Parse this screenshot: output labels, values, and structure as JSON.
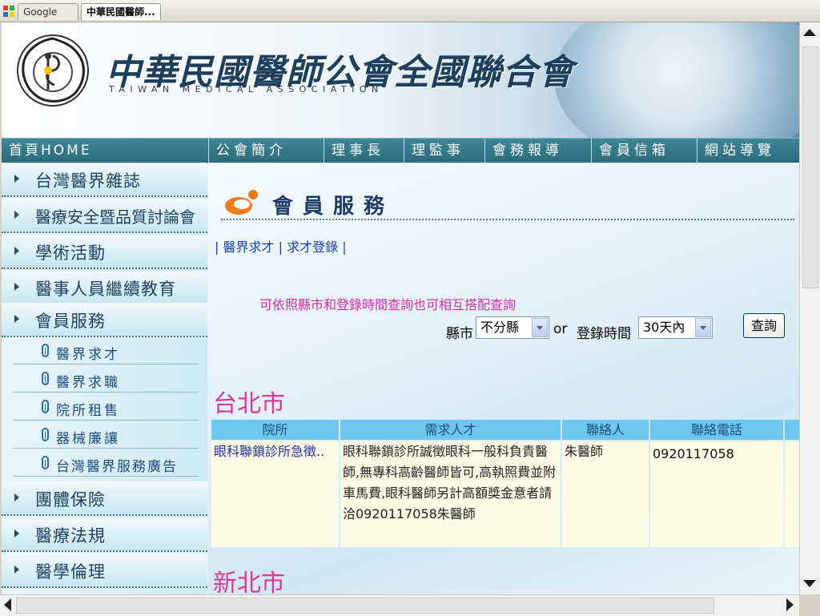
{
  "browser": {
    "tabs": [
      {
        "label": "Google"
      },
      {
        "label": "中華民國醫師..."
      }
    ]
  },
  "header": {
    "title": "中華民國醫師公會全國聯合會",
    "subtitle": "TAIWAN MEDICAL ASSOCIATION"
  },
  "nav": {
    "items": [
      {
        "label": "首頁HOME"
      },
      {
        "label": "公會簡介"
      },
      {
        "label": "理事長"
      },
      {
        "label": "理監事"
      },
      {
        "label": "會務報導"
      },
      {
        "label": "會員信箱"
      },
      {
        "label": "網站導覽"
      }
    ]
  },
  "sidebar": {
    "items": [
      {
        "label": "台灣醫界雜誌"
      },
      {
        "label": "醫療安全暨品質討論會"
      },
      {
        "label": "學術活動"
      },
      {
        "label": "醫事人員繼續教育"
      },
      {
        "label": "會員服務"
      },
      {
        "label": "團體保險"
      },
      {
        "label": "醫療法規"
      },
      {
        "label": "醫學倫理"
      }
    ],
    "subitems": [
      {
        "label": "醫界求才"
      },
      {
        "label": "醫界求職"
      },
      {
        "label": "院所租售"
      },
      {
        "label": "器械廉讓"
      },
      {
        "label": "台灣醫界服務廣告"
      }
    ]
  },
  "main": {
    "section_title": "會員服務",
    "links": {
      "sep": "|",
      "recruit": "醫界求才",
      "register": "求才登錄"
    },
    "hint": "可依照縣市和登錄時間查詢也可相互搭配查詢",
    "filters": {
      "county_label": "縣市",
      "county_value": "不分縣",
      "or_label": "or",
      "time_label": "登錄時間",
      "time_value": "30天內",
      "query_button": "查詢"
    },
    "city1": "台北市",
    "city2": "新北市",
    "table": {
      "headers": [
        "院所",
        "需求人才",
        "聯絡人",
        "聯絡電話"
      ],
      "row": {
        "clinic": "眼科聯鎖診所急徵..",
        "need": "眼科聯鎖診所誠徵眼科一般科負責醫師,無專科高齡醫師皆可,高執照費並附車馬費,眼科醫師另計高額獎金意者請洽0920117058朱醫師",
        "contact": "朱醫師",
        "phone": "0920117058"
      }
    }
  }
}
